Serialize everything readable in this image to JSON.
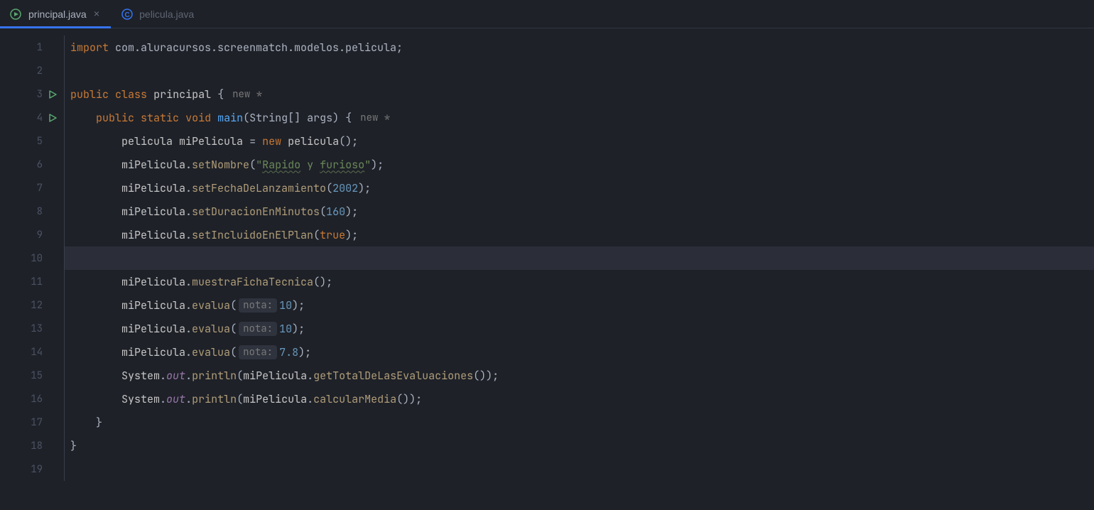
{
  "tabs": [
    {
      "label": "principal.java",
      "active": true,
      "iconColor": "#5aa76f"
    },
    {
      "label": "pelicula.java",
      "active": false,
      "iconColor": "#3574f0"
    }
  ],
  "inlays": {
    "classHint": "new *",
    "methodHint": "new *",
    "paramNota": "nota:"
  },
  "code": {
    "importKw": "import",
    "importPath": "com.aluracursos.screenmatch.modelos.pelicula",
    "publicKw": "public",
    "classKw": "class",
    "staticKw": "static",
    "voidKw": "void",
    "newKw": "new",
    "trueKw": "true",
    "className": "principal",
    "mainMethod": "main",
    "mainParams": "String[] args",
    "typePelicula": "pelicula",
    "varMiPelicula": "miPelicula",
    "ctorPelicula": "pelicula",
    "setNombre": "setNombre",
    "strRapido": "\"",
    "strRapidoTxt1": "Rapido",
    "strY": " y ",
    "strFurioso": "furioso",
    "strEndQuote": "\"",
    "setFecha": "setFechaDeLanzamiento",
    "numFecha": "2002",
    "setDuracion": "setDuracionEnMinutos",
    "numDuracion": "160",
    "setIncluido": "setIncluidoEnElPlan",
    "muestraFicha": "muestraFichaTecnica",
    "evalua": "evalua",
    "num10": "10",
    "num78": "7.8",
    "system": "System",
    "out": "out",
    "println": "println",
    "getTotal": "getTotalDeLasEvaluaciones",
    "calcularMedia": "calcularMedia"
  },
  "lineNumbers": [
    "1",
    "2",
    "3",
    "4",
    "5",
    "6",
    "7",
    "8",
    "9",
    "10",
    "11",
    "12",
    "13",
    "14",
    "15",
    "16",
    "17",
    "18",
    "19"
  ]
}
